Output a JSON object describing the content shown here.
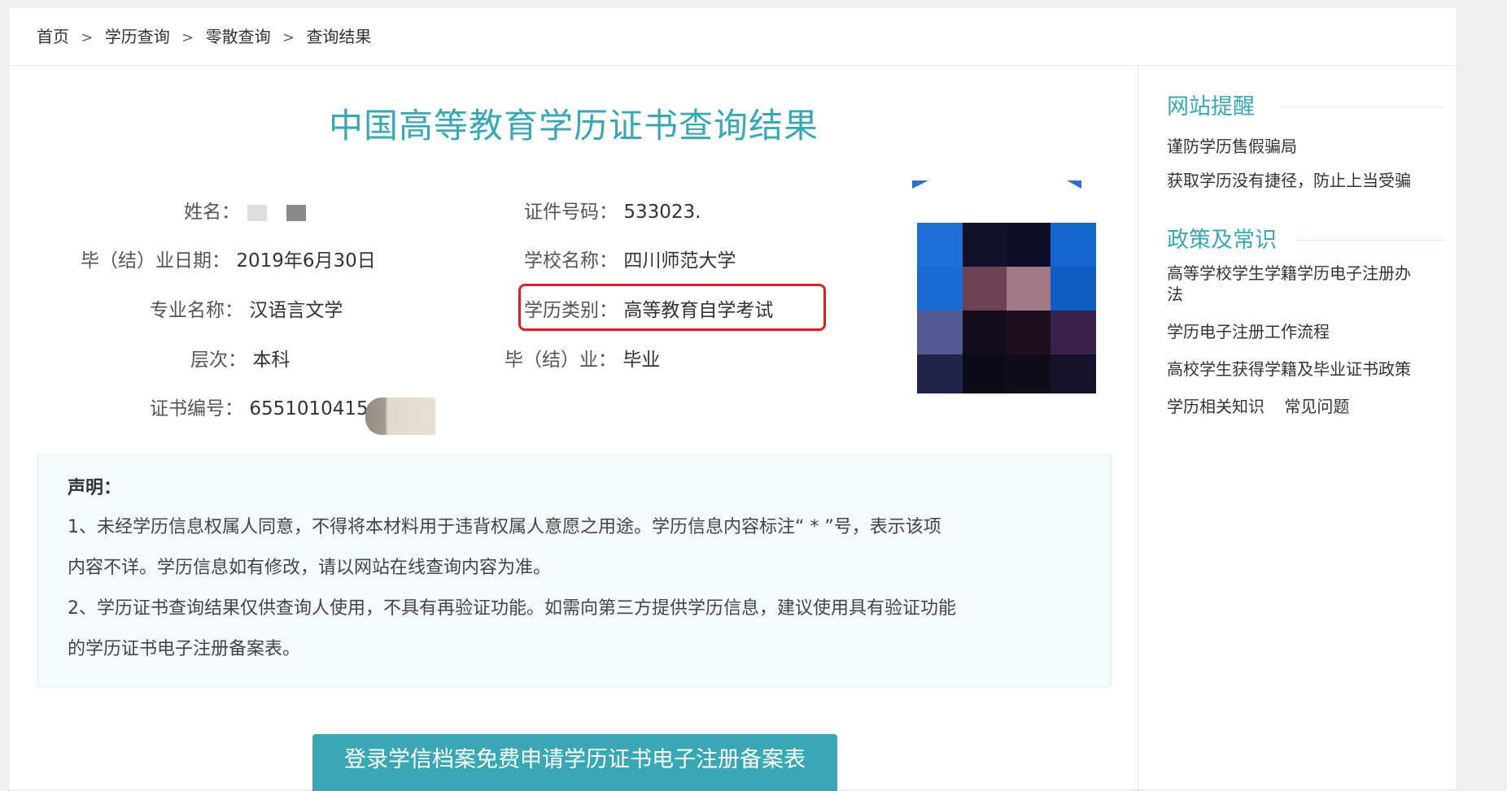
{
  "breadcrumb": {
    "items": [
      "首页",
      "学历查询",
      "零散查询",
      "查询结果"
    ],
    "separator": ">"
  },
  "title": "中国高等教育学历证书查询结果",
  "fields": {
    "name_label": "姓名：",
    "id_label": "证件号码：",
    "id_value": "533023.",
    "grad_date_label": "毕（结）业日期：",
    "grad_date_value": "2019年6月30日",
    "school_label": "学校名称：",
    "school_value": "四川师范大学",
    "major_label": "专业名称：",
    "major_value": "汉语言文学",
    "edu_type_label": "学历类别：",
    "edu_type_value": "高等教育自学考试",
    "level_label": "层次：",
    "level_value": "本科",
    "grad_status_label": "毕（结）业：",
    "grad_status_value": "毕业",
    "cert_label": "证书编号：",
    "cert_value": "6551010415"
  },
  "notice": {
    "title": "声明：",
    "line1a": "1、未经学历信息权属人同意，不得将本材料用于违背权属人意愿之用途。学历信息内容标注“ * ”号，表示该项",
    "line1b": "内容不详。学历信息如有修改，请以网站在线查询内容为准。",
    "line2a": "2、学历证书查询结果仅供查询人使用，不具有再验证功能。如需向第三方提供学历信息，建议使用具有验证功能",
    "line2b": "的学历证书电子注册备案表。"
  },
  "cta_button": "登录学信档案免费申请学历证书电子注册备案表",
  "sidebar": {
    "section1_title": "网站提醒",
    "section1_links": [
      "谨防学历售假骗局",
      "获取学历没有捷径，防止上当受骗"
    ],
    "section2_title": "政策及常识",
    "section2_links": [
      "高等学校学生学籍学历电子注册办",
      "法",
      "学历电子注册工作流程",
      "高校学生获得学籍及毕业证书政策"
    ],
    "section2_last": [
      "学历相关知识",
      "常见问题"
    ]
  },
  "colors": {
    "accent": "#3aa8b4",
    "highlight_box": "#e02020",
    "notice_bg": "#f3fbfd"
  }
}
